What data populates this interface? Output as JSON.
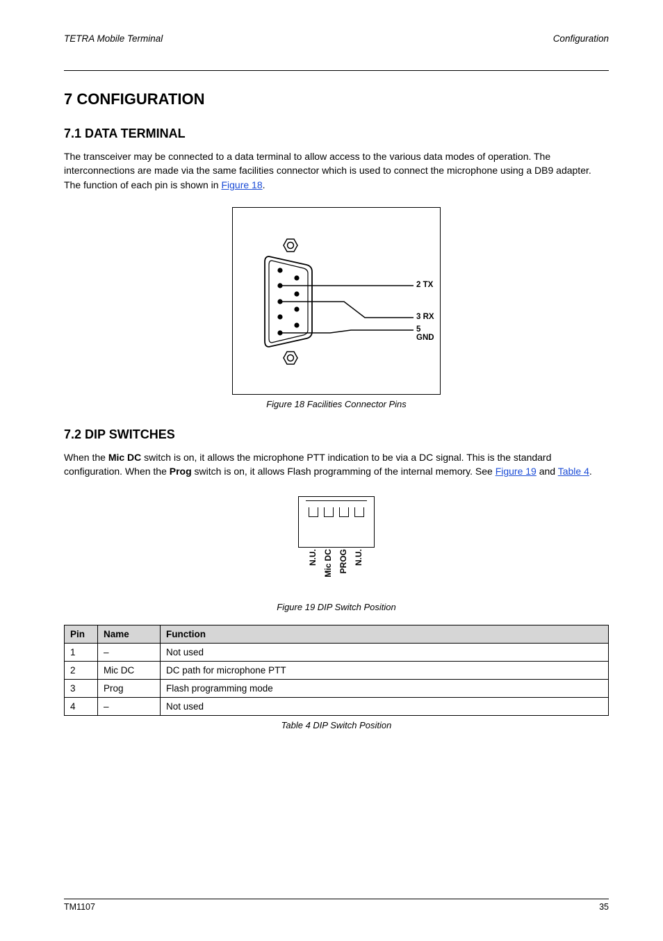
{
  "header": {
    "left": "TETRA Mobile Terminal",
    "right": "Configuration"
  },
  "title": "7  CONFIGURATION",
  "section1": {
    "heading": "7.1  DATA TERMINAL",
    "para1_a": "The transceiver may be connected to a data terminal to allow access to the various data modes of operation. The interconnections are made via the same facilities connector which is used to connect the microphone using a DB9 adapter. The function of each pin is shown in ",
    "para1_link": "Figure 18",
    "para1_b": "."
  },
  "figure1": {
    "caption": "Figure 18 Facilities Connector Pins",
    "pins": {
      "p2_label": "2 TX",
      "p3_label": "3 RX",
      "p5_label": "5 GND"
    }
  },
  "section2": {
    "heading": "7.2  DIP SWITCHES",
    "para1_a": "When the ",
    "para1_term": "Mic DC",
    "para1_b": " switch is on, it allows the microphone PTT indication to be via a DC signal. This is the standard configuration. When the ",
    "para1_term2": "Prog",
    "para1_c": " switch is on, it allows Flash programming of the internal memory. See ",
    "para1_link1": "Figure 19",
    "para1_d": " and ",
    "para1_link2": "Table 4",
    "para1_e": "."
  },
  "figure2": {
    "caption": "Figure 19 DIP Switch Position",
    "labels": [
      "N.U.",
      "Mic DC",
      "PROG",
      "N.U."
    ]
  },
  "table": {
    "caption": "Table 4 DIP Switch Position",
    "headers": [
      "Pin",
      "Name",
      "Function"
    ],
    "rows": [
      {
        "pin": "1",
        "name": "–",
        "fn": "Not used"
      },
      {
        "pin": "2",
        "name": "Mic DC",
        "fn": "DC path for microphone PTT"
      },
      {
        "pin": "3",
        "name": "Prog",
        "fn": "Flash programming mode"
      },
      {
        "pin": "4",
        "name": "–",
        "fn": "Not used"
      }
    ]
  },
  "footer": {
    "left": "TM1107",
    "right": "35"
  }
}
